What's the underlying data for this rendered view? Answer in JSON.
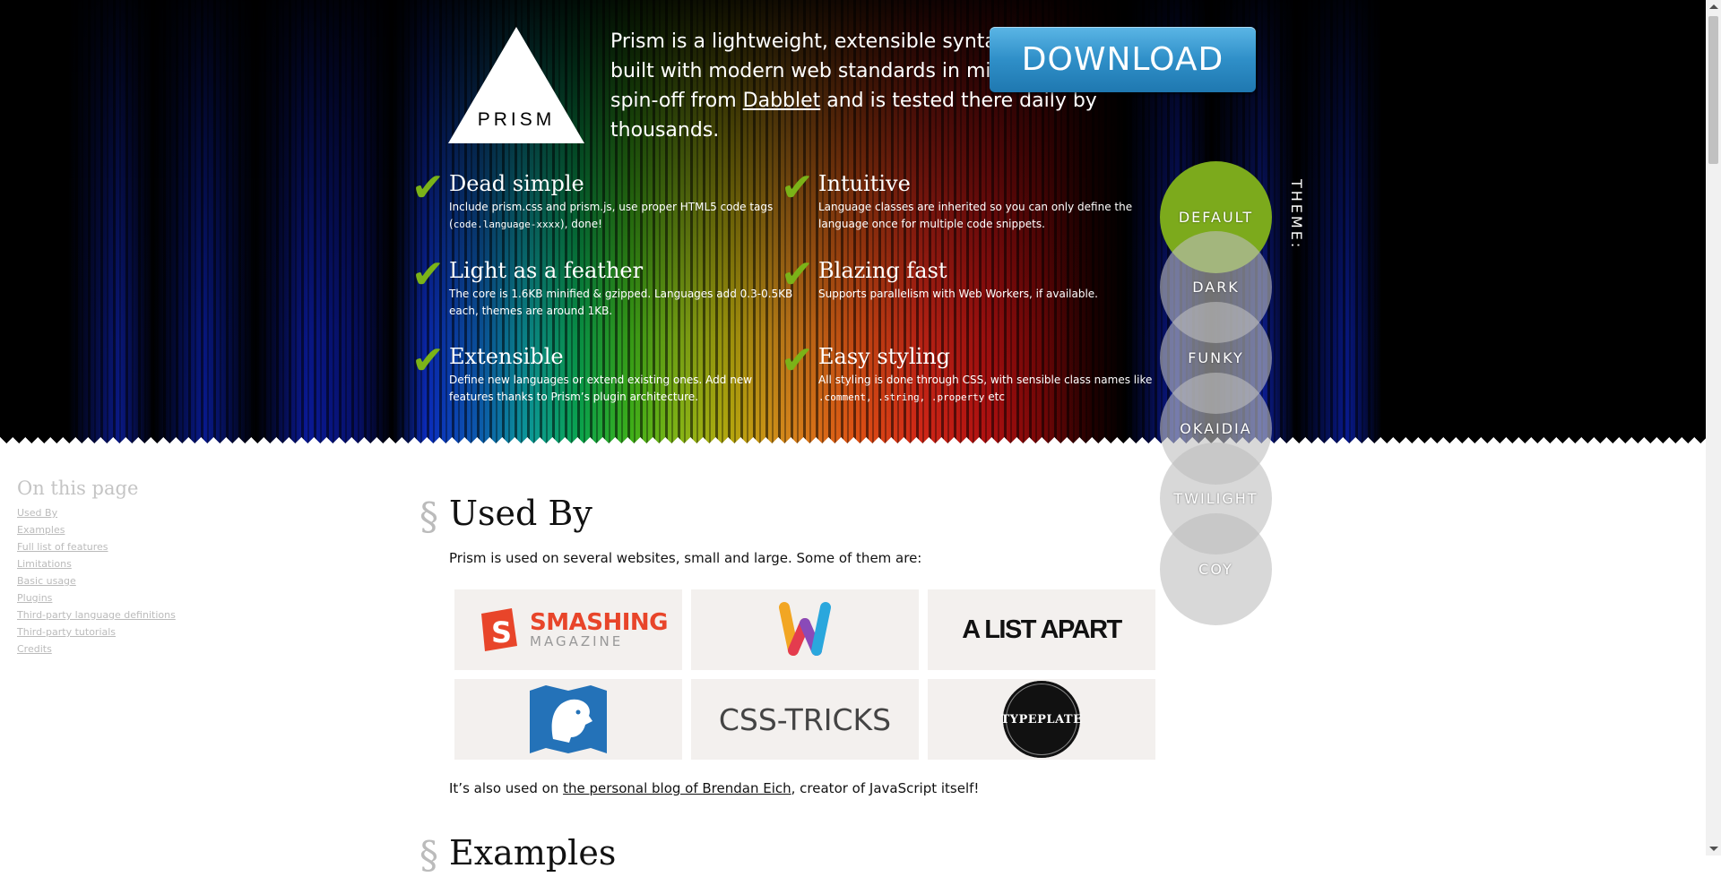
{
  "header": {
    "logo_text": "PRISM",
    "intro_before_link": "Prism is a lightweight, extensible syntax highlighter, built with modern web standards in mind. It’s a spin-off from ",
    "intro_link": "Dabblet",
    "intro_after_link": " and is tested there daily by thousands.",
    "download_label": "DOWNLOAD",
    "check_glyph": "✔"
  },
  "features": [
    {
      "title": "Dead simple",
      "desc_before": "Include prism.css and prism.js, use proper HTML5 code tags (",
      "code": "code.language-xxxx",
      "desc_after": "), done!"
    },
    {
      "title": "Intuitive",
      "desc": "Language classes are inherited so you can only define the language once for multiple code snippets."
    },
    {
      "title": "Light as a feather",
      "desc": "The core is 1.6KB minified & gzipped. Languages add 0.3-0.5KB each, themes are around 1KB."
    },
    {
      "title": "Blazing fast",
      "desc": "Supports parallelism with Web Workers, if available."
    },
    {
      "title": "Extensible",
      "desc": "Define new languages or extend existing ones. Add new features thanks to Prism’s plugin architecture."
    },
    {
      "title": "Easy styling",
      "desc_before": "All styling is done through CSS, with sensible class names like ",
      "code": ".comment, .string, .property",
      "desc_after": " etc"
    }
  ],
  "theme": {
    "label": "THEME:",
    "options": [
      "DEFAULT",
      "DARK",
      "FUNKY",
      "OKAIDIA",
      "TWILIGHT",
      "COY"
    ],
    "active": "DEFAULT"
  },
  "toc": {
    "title": "On this page",
    "items": [
      "Used By",
      "Examples",
      "Full list of features",
      "Limitations",
      "Basic usage",
      "Plugins",
      "Third-party language definitions",
      "Third-party tutorials",
      "Credits"
    ]
  },
  "main": {
    "section_sign": "§",
    "used_by_title": "Used By",
    "used_by_intro": "Prism is used on several websites, small and large. Some of them are:",
    "logos": {
      "smashing_1": "SMASHING",
      "smashing_2": "MAGAZINE",
      "alistapart": "A LIST APART",
      "csstricks": "CSS-TRICKS",
      "typeplate": "TYPEPLATE"
    },
    "also_used_before": "It’s also used on ",
    "also_used_link": "the personal blog of Brendan Eich",
    "also_used_after": ", creator of JavaScript itself!",
    "examples_title": "Examples"
  },
  "colors": {
    "accent_green": "#7bb318",
    "download_blue": "#2f8fc8",
    "theme_active": "#7caa1c"
  }
}
